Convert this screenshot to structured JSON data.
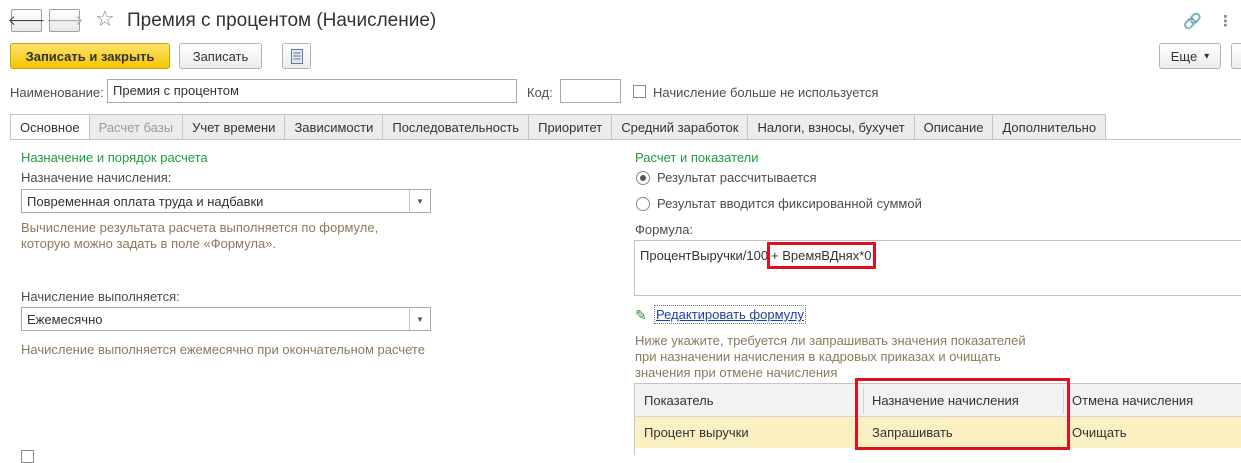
{
  "window": {
    "title": "Премия с процентом (Начисление)",
    "back_icon": "arrow-left-icon",
    "forward_icon": "arrow-right-icon",
    "favorite_icon": "star-icon",
    "link_icon": "link-icon",
    "menu_icon": "more-vertical-icon"
  },
  "toolbar": {
    "save_close_label": "Записать и закрыть",
    "save_label": "Записать",
    "more_label": "Еще",
    "more_arrow": "▾"
  },
  "header": {
    "name_label": "Наименование:",
    "name_value": "Премия с процентом",
    "code_label": "Код:",
    "code_value": "",
    "unused_checkbox_label": "Начисление больше не используется",
    "unused_checked": false
  },
  "tabs": [
    {
      "label": "Основное",
      "active": true,
      "disabled": false
    },
    {
      "label": "Расчет базы",
      "active": false,
      "disabled": true
    },
    {
      "label": "Учет времени",
      "active": false,
      "disabled": false
    },
    {
      "label": "Зависимости",
      "active": false,
      "disabled": false
    },
    {
      "label": "Последовательность",
      "active": false,
      "disabled": false
    },
    {
      "label": "Приоритет",
      "active": false,
      "disabled": false
    },
    {
      "label": "Средний заработок",
      "active": false,
      "disabled": false
    },
    {
      "label": "Налоги, взносы, бухучет",
      "active": false,
      "disabled": false
    },
    {
      "label": "Описание",
      "active": false,
      "disabled": false
    },
    {
      "label": "Дополнительно",
      "active": false,
      "disabled": false
    }
  ],
  "left": {
    "section_title": "Назначение и порядок расчета",
    "purpose_label": "Назначение начисления:",
    "purpose_value": "Повременная оплата труда и надбавки",
    "purpose_note_1": "Вычисление результата расчета выполняется по формуле,",
    "purpose_note_2": "которую можно задать в поле «Формула».",
    "period_label": "Начисление выполняется:",
    "period_value": "Ежемесячно",
    "period_note": "Начисление выполняется ежемесячно при окончательном расчете"
  },
  "right": {
    "section_title": "Расчет и показатели",
    "radio_calculated": "Результат рассчитывается",
    "radio_fixed": "Результат вводится фиксированной суммой",
    "selected_radio": "calculated",
    "formula_label": "Формула:",
    "formula_part1": "ПроцентВыручки/100",
    "formula_part2": "+ ВремяВДнях*0",
    "edit_formula_link": "Редактировать формулу",
    "hint_1": "Ниже укажите, требуется ли запрашивать значения показателей",
    "hint_2": "при назначении начисления в кадровых приказах и очищать",
    "hint_3": "значения при отмене начисления"
  },
  "indicators_table": {
    "columns": [
      "Показатель",
      "Назначение начисления",
      "Отмена начисления"
    ],
    "rows": [
      [
        "Процент выручки",
        "Запрашивать",
        "Очищать"
      ]
    ]
  },
  "colors": {
    "primary_button": "#f5c400",
    "section_title": "#1f9c3c",
    "highlight": "#e0101c",
    "selected_row": "#fbf0c2",
    "link": "#1a44a0"
  }
}
